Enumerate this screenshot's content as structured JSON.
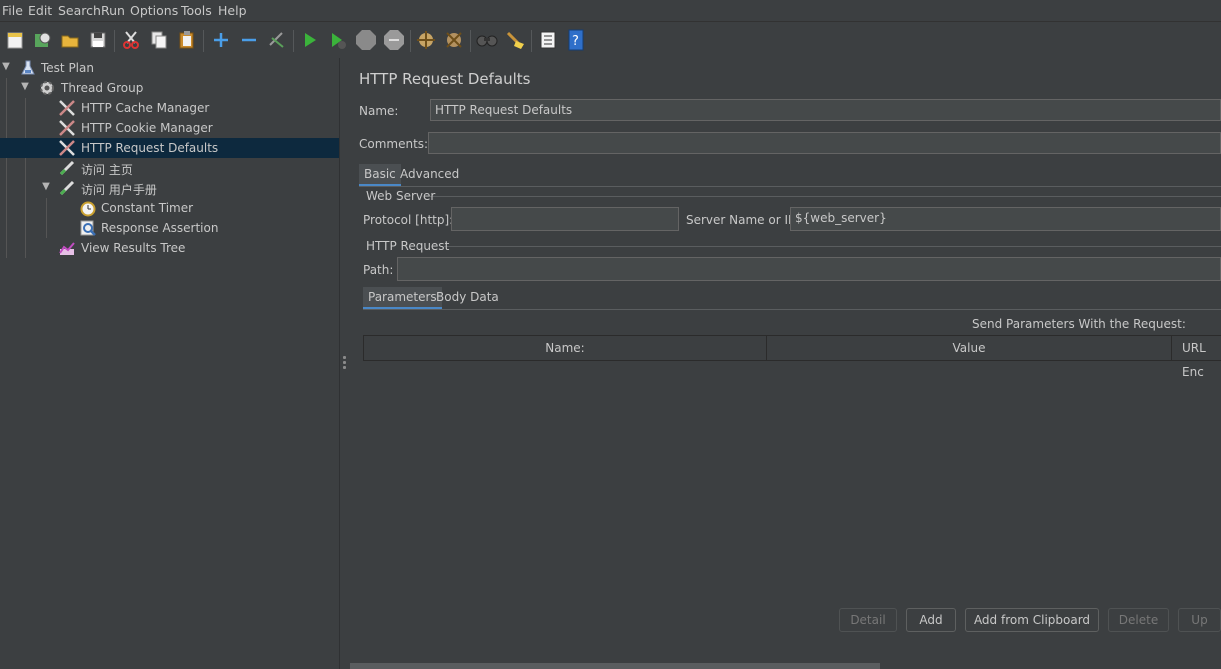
{
  "menu": [
    "File",
    "Edit",
    "Search",
    "Run",
    "Options",
    "Tools",
    "Help"
  ],
  "toolbar": [
    "new-icon",
    "templates-icon",
    "open-icon",
    "save-icon",
    "cut-icon",
    "copy-icon",
    "paste-icon",
    "expand-icon",
    "collapse-icon",
    "toggle-icon",
    "start-icon",
    "start-no-pause-icon",
    "stop-icon",
    "shutdown-icon",
    "clear-icon",
    "clear-all-icon",
    "search-icon",
    "reset-search-icon",
    "function-helper-icon",
    "help-icon"
  ],
  "tree": [
    {
      "label": "Test Plan"
    },
    {
      "label": "Thread Group"
    },
    {
      "label": "HTTP Cache Manager"
    },
    {
      "label": "HTTP Cookie Manager"
    },
    {
      "label": "HTTP Request Defaults"
    },
    {
      "label": "访问 主页"
    },
    {
      "label": "访问 用户手册"
    },
    {
      "label": "Constant Timer"
    },
    {
      "label": "Response Assertion"
    },
    {
      "label": "View Results Tree"
    }
  ],
  "panel": {
    "title": "HTTP Request Defaults",
    "name_label": "Name:",
    "name_value": "HTTP Request Defaults",
    "comments_label": "Comments:",
    "comments_value": "",
    "tabs": [
      "Basic",
      "Advanced"
    ],
    "web_server": {
      "legend": "Web Server",
      "protocol_label": "Protocol [http]:",
      "protocol_value": "",
      "server_label": "Server Name or IP:",
      "server_value": "${web_server}"
    },
    "http_request": {
      "legend": "HTTP Request",
      "path_label": "Path:",
      "path_value": ""
    },
    "subtabs": [
      "Parameters",
      "Body Data"
    ],
    "send_params_label": "Send Parameters With the Request:",
    "columns": [
      "Name:",
      "Value",
      "URL Enc"
    ],
    "buttons": [
      "Detail",
      "Add",
      "Add from Clipboard",
      "Delete",
      "Up"
    ]
  }
}
